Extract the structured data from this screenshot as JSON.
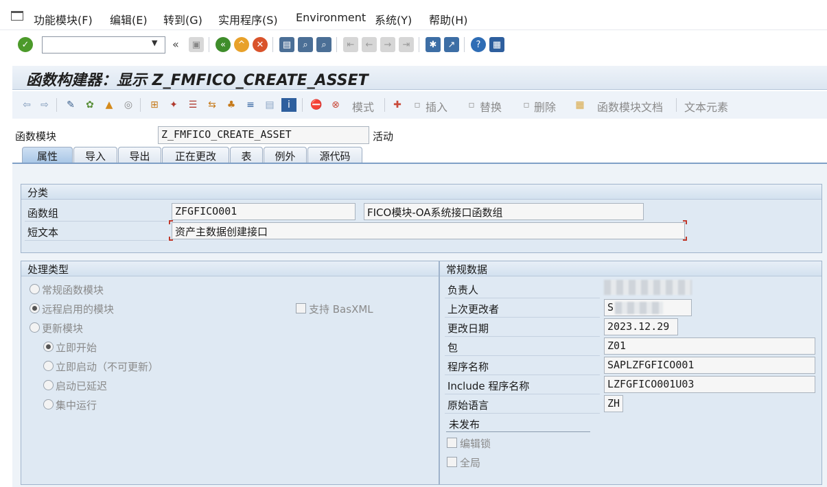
{
  "menubar": {
    "items": [
      "功能模块(F)",
      "编辑(E)",
      "转到(G)",
      "实用程序(S)",
      "Environment",
      "系统(Y)",
      "帮助(H)"
    ]
  },
  "toolbar": {
    "command_value": "",
    "icons": [
      "enter-icon",
      "back-icon",
      "exit-icon",
      "cancel-icon",
      "print-icon",
      "find-icon",
      "find-next-icon",
      "first-page-icon",
      "prev-page-icon",
      "next-page-icon",
      "last-page-icon",
      "create-session-icon",
      "shortcut-icon",
      "help-icon",
      "layout-icon"
    ]
  },
  "title": "函数构建器：显示 Z_FMFICO_CREATE_ASSET",
  "app_toolbar": {
    "mode_label": "模式",
    "insert_label": "插入",
    "replace_label": "替换",
    "delete_label": "删除",
    "doc_label": "函数模块文档",
    "text_elements_label": "文本元素"
  },
  "header": {
    "fm_label": "函数模块",
    "fm_value": "Z_FMFICO_CREATE_ASSET",
    "status": "活动"
  },
  "tabs": [
    "属性",
    "导入",
    "导出",
    "正在更改",
    "表",
    "例外",
    "源代码"
  ],
  "classification": {
    "title": "分类",
    "group_label": "函数组",
    "group_value": "ZFGFICO001",
    "group_desc": "FICO模块-OA系统接口函数组",
    "short_text_label": "短文本",
    "short_text_value": "资产主数据创建接口"
  },
  "processing": {
    "title": "处理类型",
    "normal": "常规函数模块",
    "remote": "远程启用的模块",
    "basxml": "支持 BasXML",
    "update": "更新模块",
    "start_immediately": "立即开始",
    "start_immediately_no_update": "立即启动（不可更新）",
    "start_delayed": "启动已延迟",
    "collective_run": "集中运行"
  },
  "general": {
    "title": "常规数据",
    "owner_label": "负责人",
    "last_changed_by_label": "上次更改者",
    "last_changed_by_value": "S",
    "changed_on_label": "更改日期",
    "changed_on_value": "2023.12.29",
    "package_label": "包",
    "package_value": "Z01",
    "program_label": "程序名称",
    "program_value": "SAPLZFGFICO001",
    "include_label": "Include 程序名称",
    "include_value": "LZFGFICO001U03",
    "language_label": "原始语言",
    "language_value": "ZH",
    "not_released": "未发布",
    "edit_lock": "编辑锁",
    "global": "全局"
  }
}
